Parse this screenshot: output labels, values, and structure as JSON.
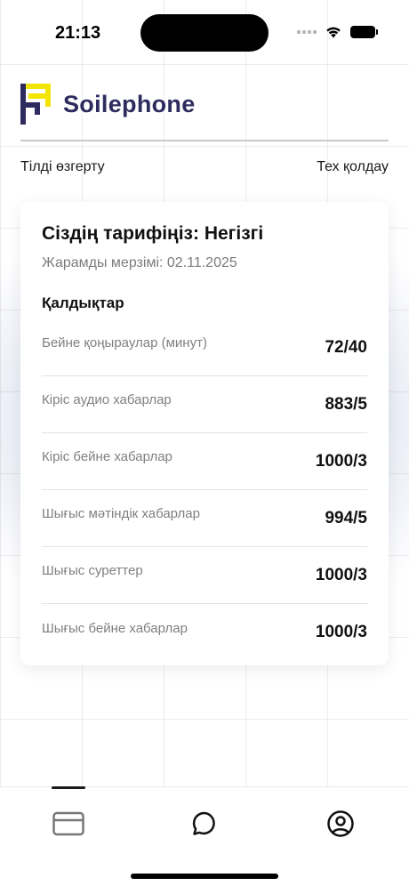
{
  "status_bar": {
    "time": "21:13",
    "icons": [
      "signal-icon",
      "wifi-icon",
      "battery-icon"
    ]
  },
  "header": {
    "brand_name": "Soilephone",
    "logo_colors": {
      "primary": "#2e2c5f",
      "accent": "#f2e600"
    },
    "links": {
      "change_language": "Тілді өзгерту",
      "support": "Тех қолдау"
    }
  },
  "tariff_card": {
    "title": "Сіздің тарифіңіз: Негізгі",
    "validity": "Жарамды мерзімі: 02.11.2025",
    "section_title": "Қалдықтар",
    "balances": [
      {
        "label": "Бейне қоңыраулар (минут)",
        "value": "72/40"
      },
      {
        "label": "Кіріс аудио хабарлар",
        "value": "883/5"
      },
      {
        "label": "Кіріс бейне хабарлар",
        "value": "1000/3"
      },
      {
        "label": "Шығыс мәтіндік хабарлар",
        "value": "994/5"
      },
      {
        "label": "Шығыс суреттер",
        "value": "1000/3"
      },
      {
        "label": "Шығыс бейне хабарлар",
        "value": "1000/3"
      }
    ]
  },
  "tab_bar": {
    "tabs": [
      {
        "icon": "card-icon",
        "active": true
      },
      {
        "icon": "chat-icon",
        "active": false
      },
      {
        "icon": "profile-icon",
        "active": false
      }
    ]
  },
  "colors": {
    "brand": "#2e2c5f",
    "accent": "#f2e600",
    "muted_text": "#808080"
  }
}
